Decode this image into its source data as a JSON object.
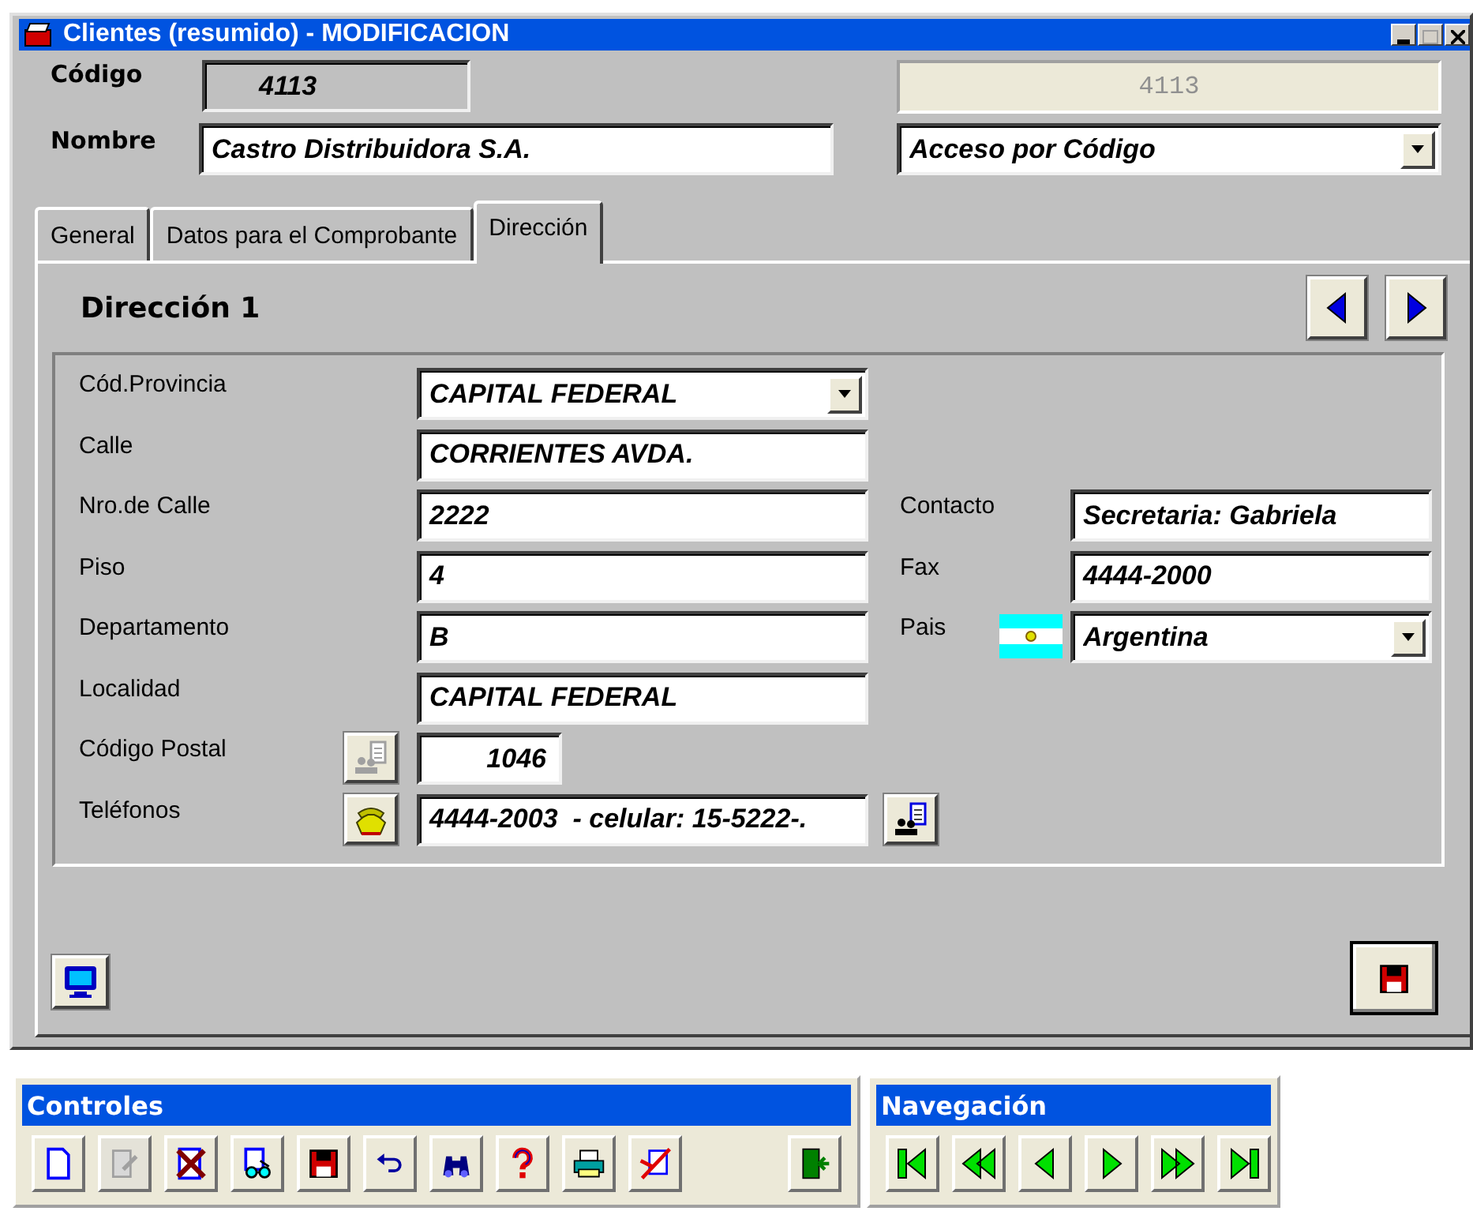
{
  "window": {
    "title": "Clientes (resumido) - MODIFICACION"
  },
  "header": {
    "code": {
      "label": "Código",
      "value": "4113",
      "readonly": true
    },
    "name": {
      "label": "Nombre",
      "value": "Castro Distribuidora S.A."
    },
    "code_display": {
      "value": "4113",
      "disabled": true
    },
    "access": {
      "value": "Acceso por Código"
    }
  },
  "tabs": [
    {
      "label": "General",
      "selected": false
    },
    {
      "label": "Datos para el Comprobante",
      "selected": false
    },
    {
      "label": "Dirección",
      "selected": true
    }
  ],
  "section": {
    "title": "Dirección 1"
  },
  "address_left": [
    {
      "label": "Cód.Provincia",
      "kind": "dropdown",
      "value": "CAPITAL FEDERAL"
    },
    {
      "label": "Calle",
      "kind": "text",
      "value": "CORRIENTES AVDA."
    },
    {
      "label": "Nro.de Calle",
      "kind": "text",
      "value": "2222"
    },
    {
      "label": "Piso",
      "kind": "text",
      "value": "4"
    },
    {
      "label": "Departamento",
      "kind": "text",
      "value": "B"
    },
    {
      "label": "Localidad",
      "kind": "text",
      "value": "CAPITAL FEDERAL"
    },
    {
      "label": "Código Postal",
      "kind": "short",
      "value": "1046",
      "lookup": {
        "kind": "contacts",
        "disabled": true
      }
    },
    {
      "label": "Teléfonos",
      "kind": "text",
      "value": "4444-2003  - celular: 15-5222-.",
      "lookup": {
        "kind": "phone",
        "disabled": false
      },
      "after": {
        "kind": "contacts",
        "disabled": false
      }
    }
  ],
  "address_right": [
    {
      "label": "Contacto",
      "kind": "text",
      "value": "Secretaria: Gabriela"
    },
    {
      "label": "Fax",
      "kind": "text",
      "value": "4444-2000"
    },
    {
      "label": "Pais",
      "kind": "dropdown",
      "value": "Argentina",
      "flag": true
    }
  ],
  "toolbars": [
    {
      "title": "Controles",
      "buttons": [
        {
          "kind": "new",
          "disabled": false
        },
        {
          "kind": "edit",
          "disabled": true
        },
        {
          "kind": "delete",
          "disabled": false
        },
        {
          "kind": "modify",
          "disabled": false
        },
        {
          "kind": "save",
          "disabled": false
        },
        {
          "kind": "undo",
          "disabled": false
        },
        {
          "kind": "find",
          "disabled": false
        },
        {
          "kind": "help",
          "disabled": false
        },
        {
          "kind": "print",
          "disabled": false
        },
        {
          "kind": "cancel",
          "disabled": false
        },
        {
          "kind": "exit",
          "disabled": false
        }
      ]
    },
    {
      "title": "Navegación",
      "buttons": [
        {
          "kind": "first",
          "disabled": false
        },
        {
          "kind": "rewind",
          "disabled": false
        },
        {
          "kind": "prev",
          "disabled": false
        },
        {
          "kind": "next",
          "disabled": false
        },
        {
          "kind": "forward",
          "disabled": false
        },
        {
          "kind": "last",
          "disabled": false
        }
      ]
    }
  ]
}
